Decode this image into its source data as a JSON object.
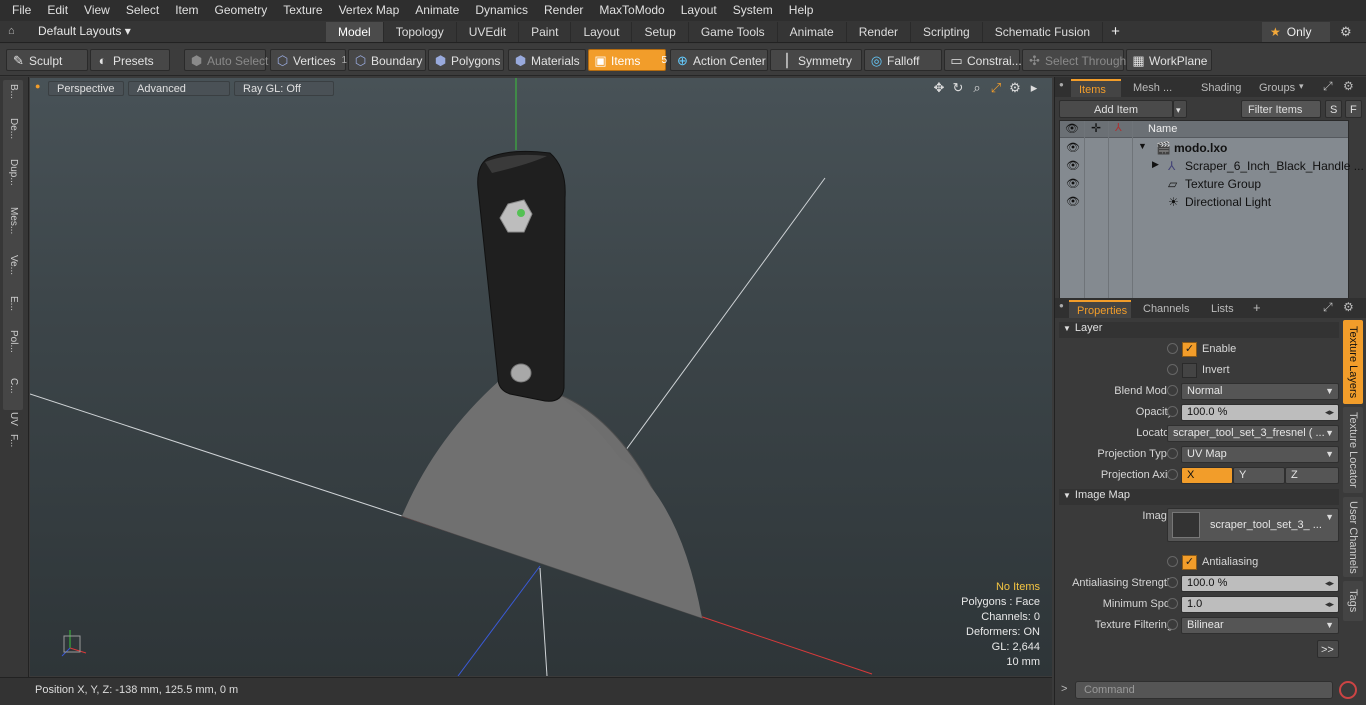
{
  "menu": [
    "File",
    "Edit",
    "View",
    "Select",
    "Item",
    "Geometry",
    "Texture",
    "Vertex Map",
    "Animate",
    "Dynamics",
    "Render",
    "MaxToModo",
    "Layout",
    "System",
    "Help"
  ],
  "layout_selector": "Default Layouts ▾",
  "layout_tabs": [
    "Model",
    "Topology",
    "UVEdit",
    "Paint",
    "Layout",
    "Setup",
    "Game Tools",
    "Animate",
    "Render",
    "Scripting",
    "Schematic Fusion"
  ],
  "only_label": "Only",
  "toolbar": {
    "sculpt": "Sculpt",
    "presets": "Presets",
    "auto_select": "Auto Select",
    "vertices": "Vertices",
    "vertices_count": "1",
    "boundary": "Boundary",
    "polygons": "Polygons",
    "materials": "Materials",
    "items": "Items",
    "items_count": "5",
    "action_center": "Action Center",
    "symmetry": "Symmetry",
    "falloff": "Falloff",
    "constraints": "Constrai...",
    "select_through": "Select Through",
    "workplane": "WorkPlane"
  },
  "left_tabs": [
    "B...",
    "De...",
    "Dup...",
    "Mes...",
    "Ve...",
    "E...",
    "Pol...",
    "C...",
    "UV",
    "F..."
  ],
  "viewport": {
    "view": "Perspective",
    "shading": "Advanced",
    "raygl": "Ray GL: Off"
  },
  "stats": {
    "items": "No Items",
    "polygons": "Polygons : Face",
    "channels": "Channels: 0",
    "deformers": "Deformers: ON",
    "gl": "GL: 2,644",
    "scale": "10 mm"
  },
  "status": "Position X, Y, Z:   -138 mm, 125.5 mm, 0 m",
  "items_panel": {
    "tabs": [
      "Items",
      "Mesh ...",
      "Shading",
      "Groups"
    ],
    "add_item": "Add Item",
    "filter": "Filter Items",
    "s": "S",
    "f": "F",
    "col_name": "Name",
    "rows": [
      "modo.lxo",
      "Scraper_6_Inch_Black_Handle ...",
      "Texture Group",
      "Directional Light"
    ]
  },
  "props_panel": {
    "tabs": [
      "Properties",
      "Channels",
      "Lists"
    ],
    "layer": "Layer",
    "enable": "Enable",
    "invert": "Invert",
    "blend_mode_label": "Blend Mode",
    "blend_mode": "Normal",
    "opacity_label": "Opacity",
    "opacity": "100.0 %",
    "locator_label": "Locator",
    "locator": "scraper_tool_set_3_fresnel ( ...",
    "projection_type_label": "Projection Type",
    "projection_type": "UV Map",
    "projection_axis_label": "Projection Axis",
    "axes": [
      "X",
      "Y",
      "Z"
    ],
    "image_map": "Image Map",
    "image_label": "Image",
    "image": "scraper_tool_set_3_ ...",
    "antialiasing": "Antialiasing",
    "aa_strength_label": "Antialiasing Strength",
    "aa_strength": "100.0 %",
    "min_spot_label": "Minimum Spot",
    "min_spot": "1.0",
    "tex_filter_label": "Texture Filtering",
    "tex_filter": "Bilinear",
    "more": ">>",
    "side_tabs": [
      "Texture Layers",
      "Texture Locator",
      "User Channels",
      "Tags"
    ],
    "command": "Command"
  },
  "colors": {
    "accent": "#f29d2a",
    "x_axis": "#d83a3a",
    "y_axis": "#3ac23a",
    "z_axis": "#3a5ad8"
  }
}
